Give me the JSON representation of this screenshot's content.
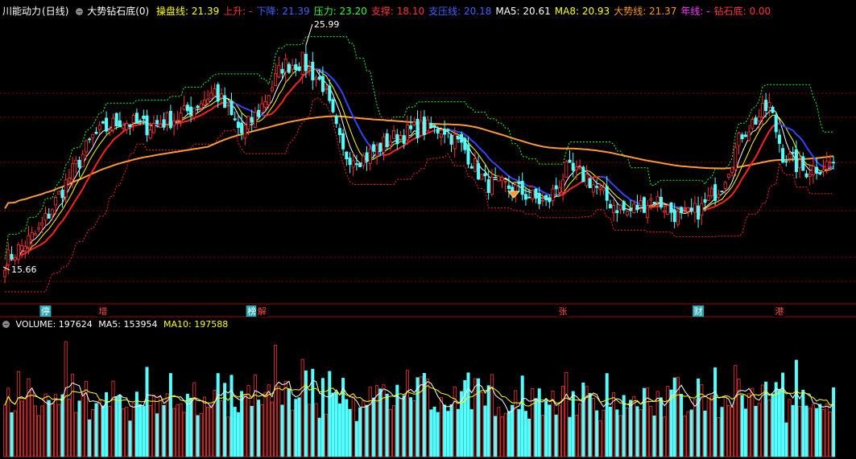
{
  "header": {
    "stock": "川能动力",
    "period": "(日线)",
    "indicator": "大势钻石底(0)",
    "values": [
      {
        "label": "操盘线: 21.39",
        "color": "#ffff00"
      },
      {
        "label": "上升: -",
        "color": "#ff3333"
      },
      {
        "label": "下降: 21.39",
        "color": "#4060ff"
      },
      {
        "label": "压力: 23.20",
        "color": "#33ff33"
      },
      {
        "label": "支撑: 18.10",
        "color": "#ff3333"
      },
      {
        "label": "支压线: 20.18",
        "color": "#4060ff"
      },
      {
        "label": "MA5: 20.61",
        "color": "#ffffff"
      },
      {
        "label": "MA8: 20.93",
        "color": "#ffff00"
      },
      {
        "label": "大势线: 21.37",
        "color": "#ff9900"
      },
      {
        "label": "年线: -",
        "color": "#ff33ff"
      },
      {
        "label": "钻石底: 0.00",
        "color": "#ff3333"
      }
    ]
  },
  "volume_header": {
    "name": "VOLUME: 197624",
    "ma5": "MA5: 153954",
    "ma10": "MA10: 197588"
  },
  "price_labels": {
    "high": "25.99",
    "low": "15.66"
  },
  "markers": [
    {
      "text": "停",
      "bg": "#2aa7b5",
      "fg": "#ffffff",
      "bar": 12
    },
    {
      "text": "增",
      "bg": "#000000",
      "fg": "#ff4444",
      "bar": 29
    },
    {
      "text": "榜",
      "bg": "#2aa7b5",
      "fg": "#ffffff",
      "bar": 73
    },
    {
      "text": "解",
      "bg": "#000000",
      "fg": "#ff4444",
      "bar": 76
    },
    {
      "text": "张",
      "bg": "#000000",
      "fg": "#ff4444",
      "bar": 165
    },
    {
      "text": "财",
      "bg": "#2aa7b5",
      "fg": "#ffffff",
      "bar": 205
    },
    {
      "text": "港",
      "bg": "#000000",
      "fg": "#ff4444",
      "bar": 229
    }
  ],
  "colors": {
    "up": "#ff3333",
    "down": "#54ffff",
    "ma5": "#ffffff",
    "ma8": "#ffff00",
    "trend": "#ff9933",
    "support": "#ff2222",
    "falling": "#3344ff",
    "resist": "#22ff22",
    "grid": "#8b0000",
    "divider": "#aa0000"
  },
  "chart_data": [
    {
      "type": "candlestick",
      "title": "川能动力 (日线)",
      "bars": 246,
      "ylim": [
        15.0,
        27.5
      ],
      "overlays": [
        "操盘线",
        "MA5",
        "MA8",
        "大势线",
        "压力",
        "支撑"
      ],
      "high": 25.99,
      "low": 15.66,
      "anchors": [
        {
          "i": 0,
          "v": 15.9
        },
        {
          "i": 10,
          "v": 17.3
        },
        {
          "i": 18,
          "v": 19.6
        },
        {
          "i": 26,
          "v": 21.8
        },
        {
          "i": 34,
          "v": 22.6
        },
        {
          "i": 42,
          "v": 22.3
        },
        {
          "i": 52,
          "v": 22.8
        },
        {
          "i": 62,
          "v": 24.0
        },
        {
          "i": 70,
          "v": 22.0
        },
        {
          "i": 75,
          "v": 23.0
        },
        {
          "i": 82,
          "v": 25.2
        },
        {
          "i": 88,
          "v": 25.4
        },
        {
          "i": 94,
          "v": 24.3
        },
        {
          "i": 100,
          "v": 21.0
        },
        {
          "i": 106,
          "v": 20.8
        },
        {
          "i": 114,
          "v": 21.7
        },
        {
          "i": 122,
          "v": 22.2
        },
        {
          "i": 130,
          "v": 22.2
        },
        {
          "i": 136,
          "v": 21.2
        },
        {
          "i": 142,
          "v": 19.6
        },
        {
          "i": 150,
          "v": 19.4
        },
        {
          "i": 160,
          "v": 18.6
        },
        {
          "i": 166,
          "v": 20.2
        },
        {
          "i": 172,
          "v": 19.9
        },
        {
          "i": 178,
          "v": 18.8
        },
        {
          "i": 184,
          "v": 18.2
        },
        {
          "i": 192,
          "v": 18.9
        },
        {
          "i": 200,
          "v": 17.9
        },
        {
          "i": 206,
          "v": 18.4
        },
        {
          "i": 212,
          "v": 19.6
        },
        {
          "i": 218,
          "v": 22.0
        },
        {
          "i": 226,
          "v": 23.3
        },
        {
          "i": 230,
          "v": 21.0
        },
        {
          "i": 236,
          "v": 20.2
        },
        {
          "i": 245,
          "v": 20.6
        }
      ]
    },
    {
      "type": "bar",
      "title": "VOLUME",
      "values_label": {
        "volume": 197624,
        "ma5": 153954,
        "ma10": 197588
      },
      "ylim": [
        0,
        360000
      ],
      "series": [
        "VOLUME",
        "MA5",
        "MA10"
      ]
    }
  ]
}
